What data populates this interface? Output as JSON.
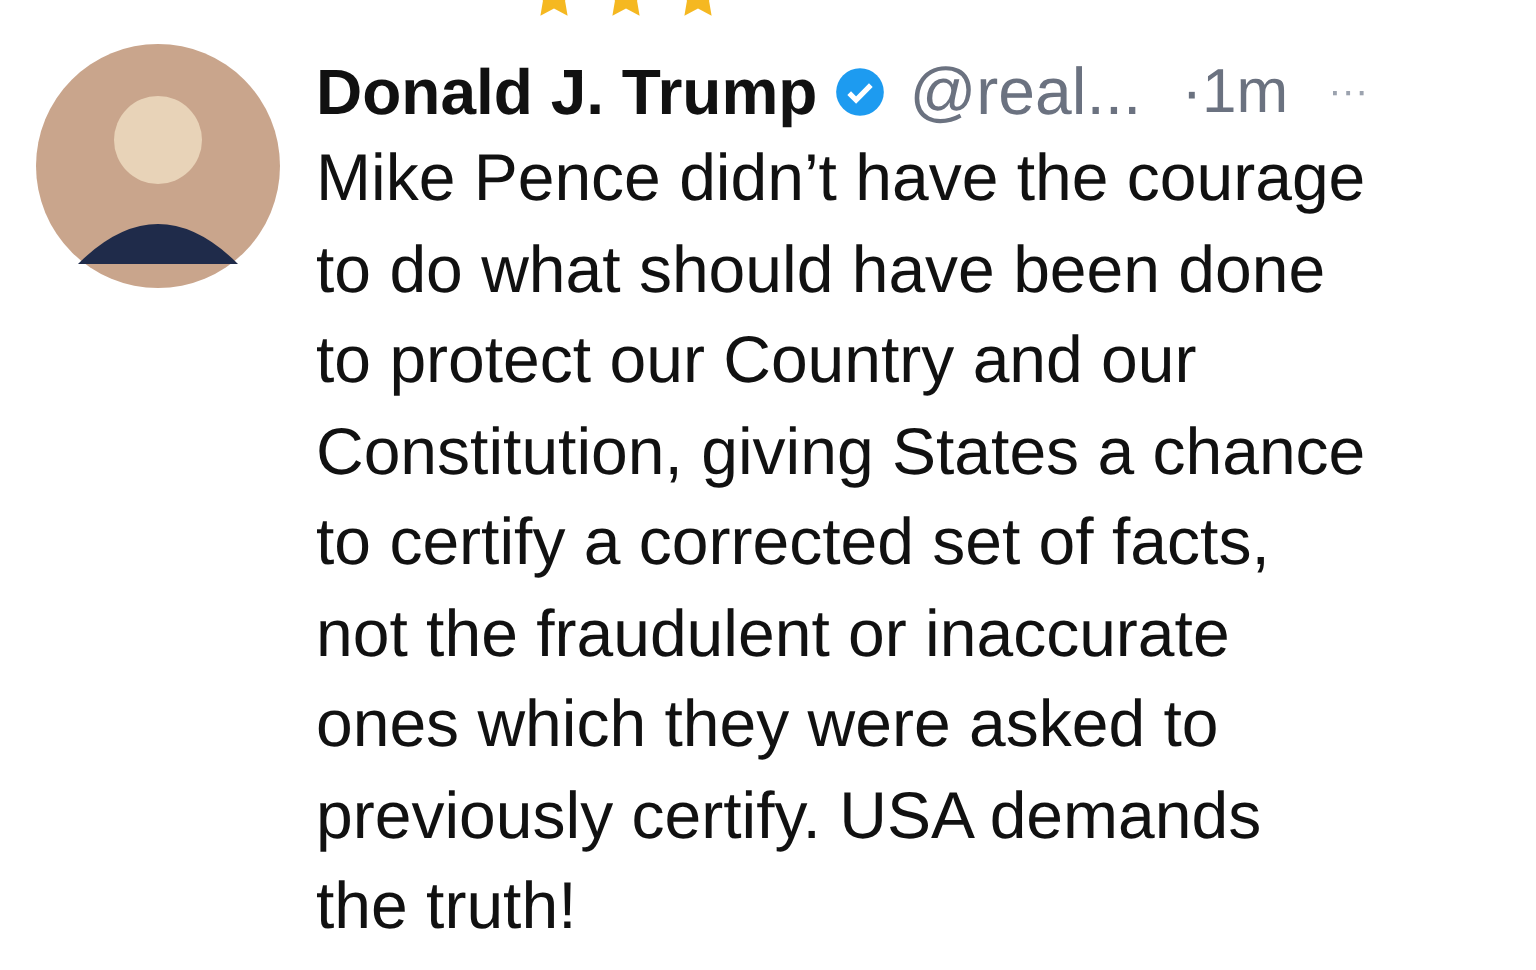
{
  "top_strip": {
    "stars": 3
  },
  "tweet": {
    "author": "Donald J. Trump",
    "verified": true,
    "handle": "@real...",
    "time": "·1m",
    "more": "···",
    "lines": [
      "Mike Pence didn’t have the courage",
      "to do what should have been done",
      "to protect our Country and our",
      "Constitution, giving States a chance",
      "to certify a corrected set of facts,",
      "not the fraudulent or inaccurate",
      "ones which they were asked to",
      "previously certify. USA demands",
      "the truth!"
    ]
  }
}
